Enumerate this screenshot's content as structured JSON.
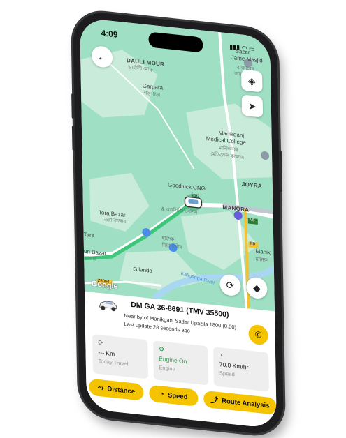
{
  "status_bar": {
    "time": "4:09"
  },
  "map": {
    "labels": {
      "dauli_mour": "DAULI MOUR",
      "dauli_mour_bn": "ডাউলী মোড়",
      "garpara": "Garpara",
      "garpara_bn": "গড়পাড়া",
      "jame_masjid": "Bazar",
      "jame_masjid_2": "Jame Masjid",
      "jame_masjid_bn": "বাজারের",
      "jame_masjid_bn2": "জামে মসজিদ",
      "college": "Manikganj",
      "college_2": "Medical College",
      "college_bn": "মানিকগঞ্জ",
      "college_bn2": "মেডিকেল কলেজ",
      "cng": "Goodluck CNG",
      "cng_2": "ion",
      "cng_bn": "& এলপিজি স্টেশন",
      "joyra": "JOYRA",
      "manora": "MANORA",
      "tora_bazar": "Tora Bazar",
      "tora_bazar_bn": "তরা বাজার",
      "shop_bn": "ছাদেক",
      "shop_bn2": "মিয়া স্টোর",
      "tara": "Tara",
      "uri_bazar": "uri Bazar",
      "uri_bazar_bn": "বাজার",
      "gilanda": "Gilanda",
      "river": "Kaliganga River",
      "manik": "Manik",
      "manik_bn": "মানিক",
      "road_n5": "N5",
      "road_r0": "R0",
      "road_z": "Z5064",
      "google": "Google"
    }
  },
  "vehicle": {
    "title": "DM GA 36-8691 (TMV 35500)",
    "location": "Near by of Manikganj Sadar Upazila 1800 (0.00)",
    "last_update": "Last update 28 seconds ago"
  },
  "cards": [
    {
      "value": "--- Km",
      "caption": "Today Travel",
      "icon": "refresh-icon"
    },
    {
      "value": "Engine On",
      "caption": "Engine",
      "icon": "engine-icon"
    },
    {
      "value": "70.0 Km/hr",
      "caption": "Speed",
      "icon": "speedometer-icon"
    }
  ],
  "actions": {
    "distance": "Distance",
    "speed": "Speed",
    "route": "Route Analysis"
  },
  "colors": {
    "accent": "#f5c400",
    "route": "#3ec77a",
    "map_bg": "#9fdfc4",
    "engine_on": "#2e9e4f"
  }
}
